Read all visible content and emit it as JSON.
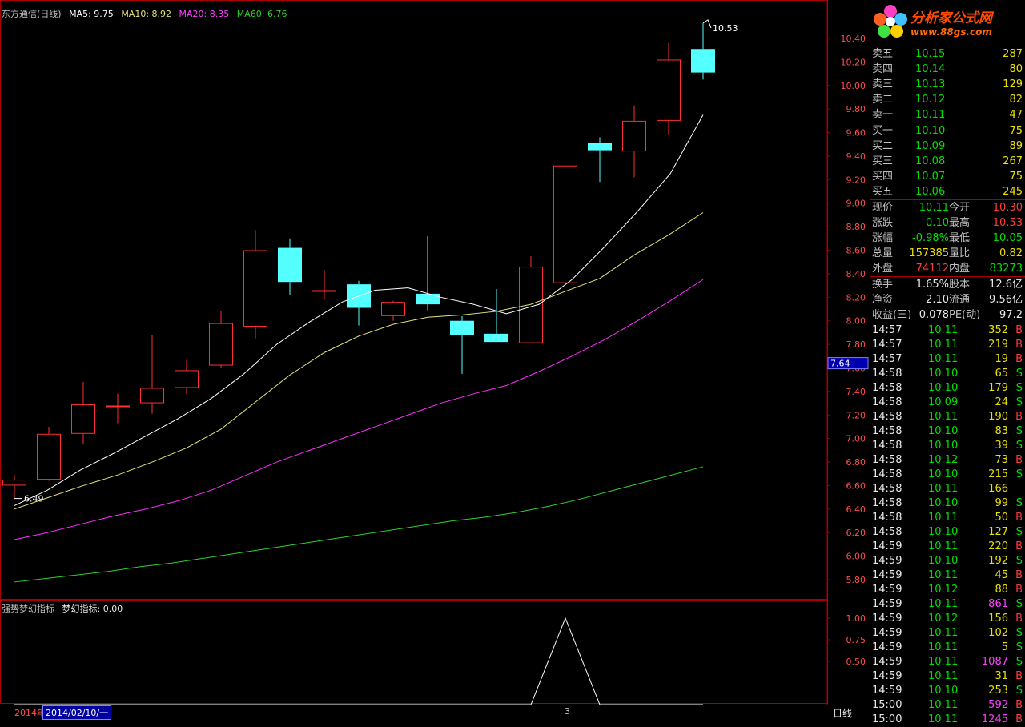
{
  "header": {
    "title": "东方通信(日线)",
    "ma5": "MA5: 9.75",
    "ma10": "MA10: 8.92",
    "ma20": "MA20: 8.35",
    "ma60": "MA60: 6.76"
  },
  "indicator": {
    "name": "强势梦幻指标",
    "value": "梦幻指标: 0.00",
    "y_ticks": [
      "1.00",
      "0.75",
      "0.50"
    ],
    "x_marker": "3"
  },
  "colors": {
    "up": "#ff3030",
    "down": "#54ffff",
    "ma5": "#ffffff",
    "ma10": "#e6e37a",
    "ma20": "#ff30ff",
    "ma60": "#30d030",
    "border": "#aa0000"
  },
  "chart_data": {
    "type": "candlestick",
    "ylim": [
      5.7,
      10.5
    ],
    "y_ticks": [
      "10.40",
      "10.20",
      "10.00",
      "9.80",
      "9.60",
      "9.40",
      "9.20",
      "9.00",
      "8.80",
      "8.60",
      "8.40",
      "8.20",
      "8.00",
      "7.80",
      "7.60",
      "7.40",
      "7.20",
      "7.00",
      "6.80",
      "6.60",
      "6.40",
      "6.20",
      "6.00",
      "5.80"
    ],
    "current_price_label": "7.64",
    "high_label": "10.53",
    "low_label": "6.49",
    "candles": [
      {
        "o": 6.6,
        "h": 6.69,
        "l": 6.49,
        "c": 6.65
      },
      {
        "o": 6.65,
        "h": 7.1,
        "l": 6.64,
        "c": 7.04
      },
      {
        "o": 7.04,
        "h": 7.48,
        "l": 6.95,
        "c": 7.29
      },
      {
        "o": 7.27,
        "h": 7.38,
        "l": 7.13,
        "c": 7.28
      },
      {
        "o": 7.3,
        "h": 7.88,
        "l": 7.21,
        "c": 7.43
      },
      {
        "o": 7.43,
        "h": 7.67,
        "l": 7.38,
        "c": 7.58
      },
      {
        "o": 7.62,
        "h": 8.08,
        "l": 7.6,
        "c": 7.98
      },
      {
        "o": 7.95,
        "h": 8.77,
        "l": 7.85,
        "c": 8.6
      },
      {
        "o": 8.62,
        "h": 8.7,
        "l": 8.22,
        "c": 8.33
      },
      {
        "o": 8.26,
        "h": 8.43,
        "l": 8.18,
        "c": 8.26
      },
      {
        "o": 8.31,
        "h": 8.34,
        "l": 7.96,
        "c": 8.11
      },
      {
        "o": 8.04,
        "h": 8.17,
        "l": 8.0,
        "c": 8.16
      },
      {
        "o": 8.23,
        "h": 8.72,
        "l": 8.09,
        "c": 8.14
      },
      {
        "o": 8.0,
        "h": 8.04,
        "l": 7.55,
        "c": 7.88
      },
      {
        "o": 7.89,
        "h": 8.27,
        "l": 7.82,
        "c": 7.82
      },
      {
        "o": 7.81,
        "h": 8.55,
        "l": 7.81,
        "c": 8.46
      },
      {
        "o": 8.32,
        "h": 9.32,
        "l": 8.31,
        "c": 9.32
      },
      {
        "o": 9.51,
        "h": 9.56,
        "l": 9.18,
        "c": 9.45
      },
      {
        "o": 9.44,
        "h": 9.83,
        "l": 9.22,
        "c": 9.7
      },
      {
        "o": 9.7,
        "h": 10.36,
        "l": 9.58,
        "c": 10.22
      },
      {
        "o": 10.31,
        "h": 10.53,
        "l": 10.05,
        "c": 10.11
      }
    ],
    "ma5": [
      6.43,
      6.56,
      6.73,
      6.87,
      7.02,
      7.17,
      7.34,
      7.55,
      7.8,
      7.99,
      8.16,
      8.26,
      8.28,
      8.2,
      8.14,
      8.06,
      8.14,
      8.35,
      8.63,
      8.93,
      9.25,
      9.75
    ],
    "ma10": [
      6.4,
      6.5,
      6.6,
      6.69,
      6.8,
      6.92,
      7.08,
      7.31,
      7.54,
      7.73,
      7.87,
      7.97,
      8.03,
      8.05,
      8.08,
      8.14,
      8.25,
      8.36,
      8.56,
      8.73,
      8.92
    ],
    "ma20": [
      6.14,
      6.2,
      6.27,
      6.34,
      6.4,
      6.47,
      6.56,
      6.68,
      6.8,
      6.9,
      7.0,
      7.1,
      7.2,
      7.3,
      7.38,
      7.45,
      7.57,
      7.7,
      7.84,
      8.0,
      8.17,
      8.35
    ],
    "ma60": [
      5.78,
      5.81,
      5.84,
      5.87,
      5.91,
      5.94,
      5.98,
      6.02,
      6.06,
      6.1,
      6.14,
      6.18,
      6.22,
      6.26,
      6.3,
      6.33,
      6.37,
      6.42,
      6.48,
      6.55,
      6.62,
      6.69,
      6.76
    ],
    "indicator": [
      0,
      0,
      0,
      0,
      0,
      0,
      0,
      0,
      0,
      0,
      0,
      0,
      0,
      0,
      0,
      0,
      1,
      0,
      0,
      0,
      0
    ]
  },
  "bottom": {
    "year_label": "2014年",
    "date_label": "2014/02/10/一",
    "period_label": "日线"
  },
  "quote": {
    "asks": [
      {
        "label": "卖五",
        "price": "10.15",
        "vol": "287"
      },
      {
        "label": "卖四",
        "price": "10.14",
        "vol": "80"
      },
      {
        "label": "卖三",
        "price": "10.13",
        "vol": "129"
      },
      {
        "label": "卖二",
        "price": "10.12",
        "vol": "82"
      },
      {
        "label": "卖一",
        "price": "10.11",
        "vol": "47"
      }
    ],
    "bids": [
      {
        "label": "买一",
        "price": "10.10",
        "vol": "75"
      },
      {
        "label": "买二",
        "price": "10.09",
        "vol": "89"
      },
      {
        "label": "买三",
        "price": "10.08",
        "vol": "267"
      },
      {
        "label": "买四",
        "price": "10.07",
        "vol": "75"
      },
      {
        "label": "买五",
        "price": "10.06",
        "vol": "245"
      }
    ],
    "stats": [
      {
        "l1": "现价",
        "v1": "10.11",
        "c1": "green",
        "l2": "今开",
        "v2": "10.30",
        "c2": "red"
      },
      {
        "l1": "涨跌",
        "v1": "-0.10",
        "c1": "green",
        "l2": "最高",
        "v2": "10.53",
        "c2": "red"
      },
      {
        "l1": "涨幅",
        "v1": "-0.98%",
        "c1": "green",
        "l2": "最低",
        "v2": "10.05",
        "c2": "green"
      },
      {
        "l1": "总量",
        "v1": "157385",
        "c1": "yellow",
        "l2": "量比",
        "v2": "0.82",
        "c2": "yellow"
      },
      {
        "l1": "外盘",
        "v1": "74112",
        "c1": "red",
        "l2": "内盘",
        "v2": "83273",
        "c2": "green"
      }
    ],
    "fund": [
      {
        "l1": "换手",
        "v1": "1.65%",
        "l2": "股本",
        "v2": "12.6亿"
      },
      {
        "l1": "净资",
        "v1": "2.10",
        "l2": "流通",
        "v2": "9.56亿"
      },
      {
        "l1": "收益(三)",
        "v1": "0.078",
        "l2": "PE(动)",
        "v2": "97.2"
      }
    ],
    "ticks": [
      {
        "t": "14:57",
        "p": "10.11",
        "v": "352",
        "s": "B"
      },
      {
        "t": "14:57",
        "p": "10.11",
        "v": "219",
        "s": "B"
      },
      {
        "t": "14:57",
        "p": "10.11",
        "v": "19",
        "s": "B"
      },
      {
        "t": "14:58",
        "p": "10.10",
        "v": "65",
        "s": "S"
      },
      {
        "t": "14:58",
        "p": "10.10",
        "v": "179",
        "s": "S"
      },
      {
        "t": "14:58",
        "p": "10.09",
        "v": "24",
        "s": "S"
      },
      {
        "t": "14:58",
        "p": "10.11",
        "v": "190",
        "s": "B"
      },
      {
        "t": "14:58",
        "p": "10.10",
        "v": "83",
        "s": "S"
      },
      {
        "t": "14:58",
        "p": "10.10",
        "v": "39",
        "s": "S"
      },
      {
        "t": "14:58",
        "p": "10.12",
        "v": "73",
        "s": "B"
      },
      {
        "t": "14:58",
        "p": "10.10",
        "v": "215",
        "s": "S"
      },
      {
        "t": "14:58",
        "p": "10.11",
        "v": "166",
        "s": ""
      },
      {
        "t": "14:58",
        "p": "10.10",
        "v": "99",
        "s": "S"
      },
      {
        "t": "14:58",
        "p": "10.11",
        "v": "50",
        "s": "B"
      },
      {
        "t": "14:58",
        "p": "10.10",
        "v": "127",
        "s": "S"
      },
      {
        "t": "14:59",
        "p": "10.11",
        "v": "220",
        "s": "B"
      },
      {
        "t": "14:59",
        "p": "10.10",
        "v": "192",
        "s": "S"
      },
      {
        "t": "14:59",
        "p": "10.11",
        "v": "45",
        "s": "B"
      },
      {
        "t": "14:59",
        "p": "10.12",
        "v": "88",
        "s": "B"
      },
      {
        "t": "14:59",
        "p": "10.11",
        "v": "861",
        "s": "S"
      },
      {
        "t": "14:59",
        "p": "10.12",
        "v": "156",
        "s": "B"
      },
      {
        "t": "14:59",
        "p": "10.11",
        "v": "102",
        "s": "S"
      },
      {
        "t": "14:59",
        "p": "10.11",
        "v": "5",
        "s": "S"
      },
      {
        "t": "14:59",
        "p": "10.11",
        "v": "1087",
        "s": "S"
      },
      {
        "t": "14:59",
        "p": "10.11",
        "v": "31",
        "s": "B"
      },
      {
        "t": "14:59",
        "p": "10.10",
        "v": "253",
        "s": "S"
      },
      {
        "t": "15:00",
        "p": "10.11",
        "v": "592",
        "s": "B"
      },
      {
        "t": "15:00",
        "p": "10.11",
        "v": "1245",
        "s": "B"
      }
    ]
  },
  "logo": {
    "title": "分析家公式网",
    "url": "www.88gs.com"
  }
}
